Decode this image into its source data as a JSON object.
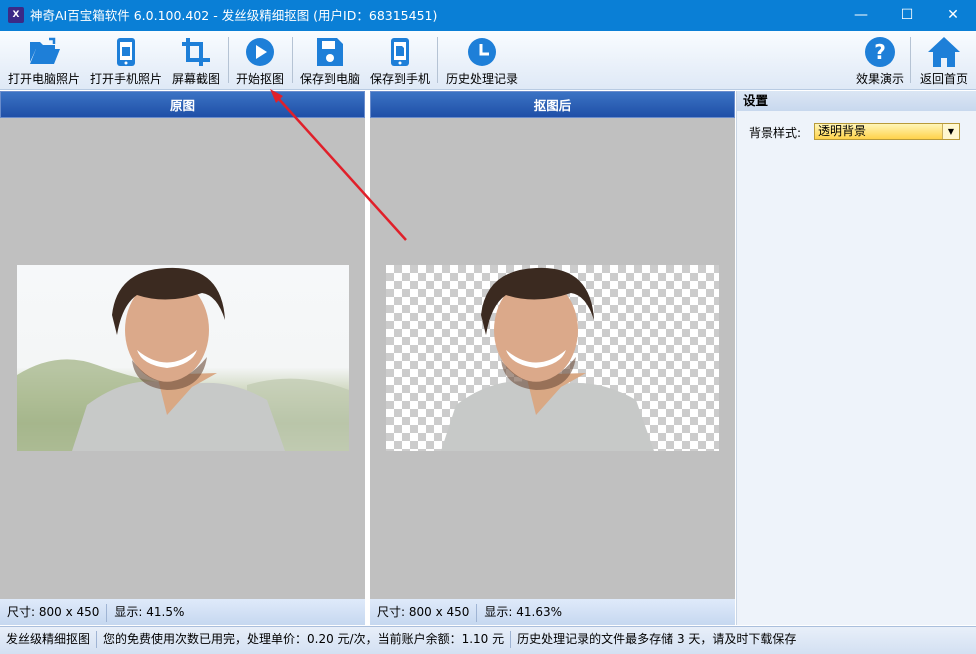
{
  "window": {
    "title": "神奇AI百宝箱软件 6.0.100.402 - 发丝级精细抠图 (用户ID：68315451)",
    "app_icon_text": "X",
    "minimize": "—",
    "maximize": "☐",
    "close": "✕"
  },
  "toolbar": {
    "open_pc": "打开电脑照片",
    "open_phone": "打开手机照片",
    "screenshot": "屏幕截图",
    "start": "开始抠图",
    "save_pc": "保存到电脑",
    "save_phone": "保存到手机",
    "history": "历史处理记录",
    "demo": "效果演示",
    "home": "返回首页"
  },
  "original": {
    "title": "原图",
    "size": "尺寸: 800 x 450",
    "zoom": "显示: 41.5%"
  },
  "result": {
    "title": "抠图后",
    "size": "尺寸: 800 x 450",
    "zoom": "显示: 41.63%"
  },
  "settings": {
    "title": "设置",
    "bg_label": "背景样式:",
    "bg_value": "透明背景"
  },
  "status": {
    "mode": "发丝级精细抠图",
    "quota": "您的免费使用次数已用完，处理单价：0.20 元/次，当前账户余额：1.10 元",
    "history_note": "历史处理记录的文件最多存储 3 天，请及时下载保存"
  },
  "colors": {
    "titlebar": "#0a7fd6",
    "icon_blue": "#1e7fd8",
    "panel_header": "#2a5db3",
    "arrow": "#e0202a"
  }
}
